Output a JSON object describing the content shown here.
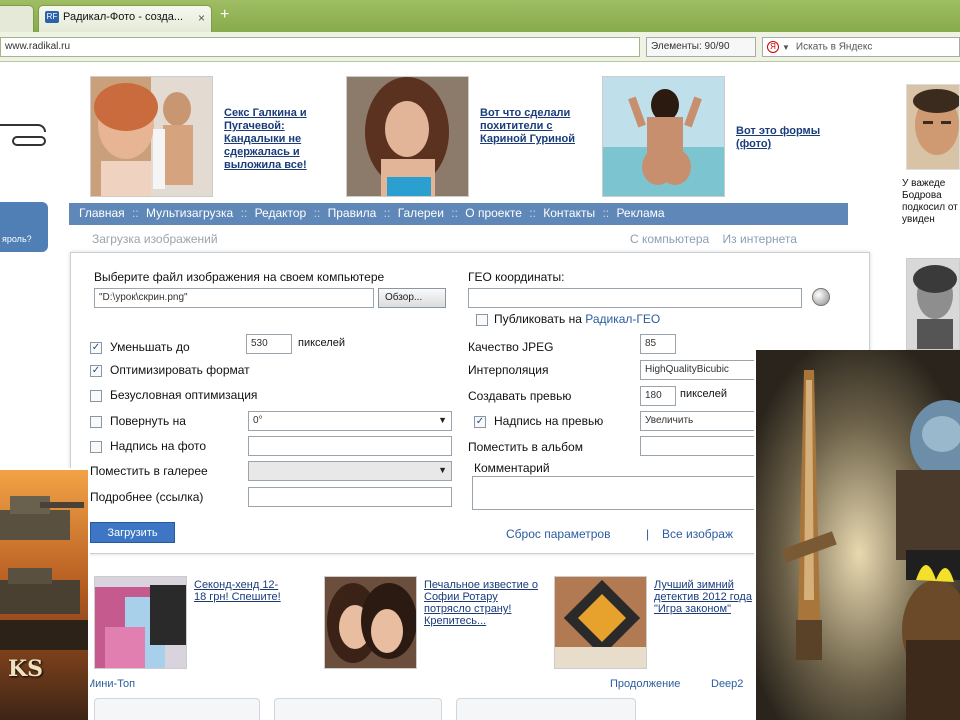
{
  "browser": {
    "tab_title": "Радикал-Фото - созда...",
    "tab_favicon": "RF",
    "tab_close": "×",
    "new_tab": "+",
    "url": "www.radikal.ru",
    "elements_counter": "Элементы: 90/90",
    "search_placeholder": "Искать в Яндекс",
    "search_icon_text": "Я"
  },
  "side_button_text": "яроль?",
  "ads": [
    {
      "text": "Секс Галкина и Пугачевой: Кандалыки не сдержалась и выложила все!"
    },
    {
      "text": "Вот что сделали похитители с Кариной Гуриной"
    },
    {
      "text": "Вот это формы (фото)"
    }
  ],
  "nav": {
    "items": [
      "Главная",
      "Мультизагрузка",
      "Редактор",
      "Правила",
      "Галереи",
      "О проекте",
      "Контакты",
      "Реклама"
    ],
    "separator": "::"
  },
  "subnav": {
    "left": "Загрузка изображений",
    "right": [
      "С компьютера",
      "Из интернета"
    ]
  },
  "form": {
    "file_label": "Выберите файл изображения на своем компьютере",
    "file_value": "\"D:\\урок\\скрин.png\"",
    "browse_button": "Обзор...",
    "geo_label": "ГЕО координаты:",
    "geo_value": "",
    "publish_geo_prefix": "Публиковать на ",
    "publish_geo_link": "Радикал-ГЕО",
    "reduce_label": "Уменьшать до",
    "reduce_value": "530",
    "reduce_unit": "пикселей",
    "optimize_label": "Оптимизировать формат",
    "uncond_label": "Безусловная оптимизация",
    "rotate_label": "Повернуть на",
    "rotate_value": "0°",
    "caption_label": "Надпись на фото",
    "gallery_label": "Поместить в галерее",
    "more_label": "Подробнее (ссылка)",
    "jpeg_label": "Качество JPEG",
    "jpeg_value": "85",
    "interp_label": "Интерполяция",
    "interp_value": "HighQualityBicubic",
    "preview_label": "Создавать превью",
    "preview_value": "180",
    "preview_unit": "пикселей",
    "preview_caption_label": "Надпись на превью",
    "preview_caption_value": "Увеличить",
    "album_label": "Поместить в альбом",
    "comment_label": "Комментарий",
    "upload_button": "Загрузить",
    "reset_link": "Сброс параметров",
    "divider": "|",
    "all_images_link": "Все изображ"
  },
  "bottom_news": [
    {
      "text": "Секонд-хенд 12-18 грн! Спешите!"
    },
    {
      "text": "Печальное известие о Софии Ротару потрясло страну! Крепитесь..."
    },
    {
      "text": "Лучший зимний детектив 2012 года \"Игра законом\""
    }
  ],
  "bottom_left_link": "Мини-Топ",
  "bottom_right_link": "Продолжение",
  "bottom_right_link2": "Deep2",
  "right_col_text": "У важеде Бодрова подкосил от увиден",
  "overlay_left_text": "KS",
  "colors": {
    "nav_bg": "#5f88b8",
    "link": "#2a5d9f",
    "upload_btn": "#3d76c4"
  }
}
